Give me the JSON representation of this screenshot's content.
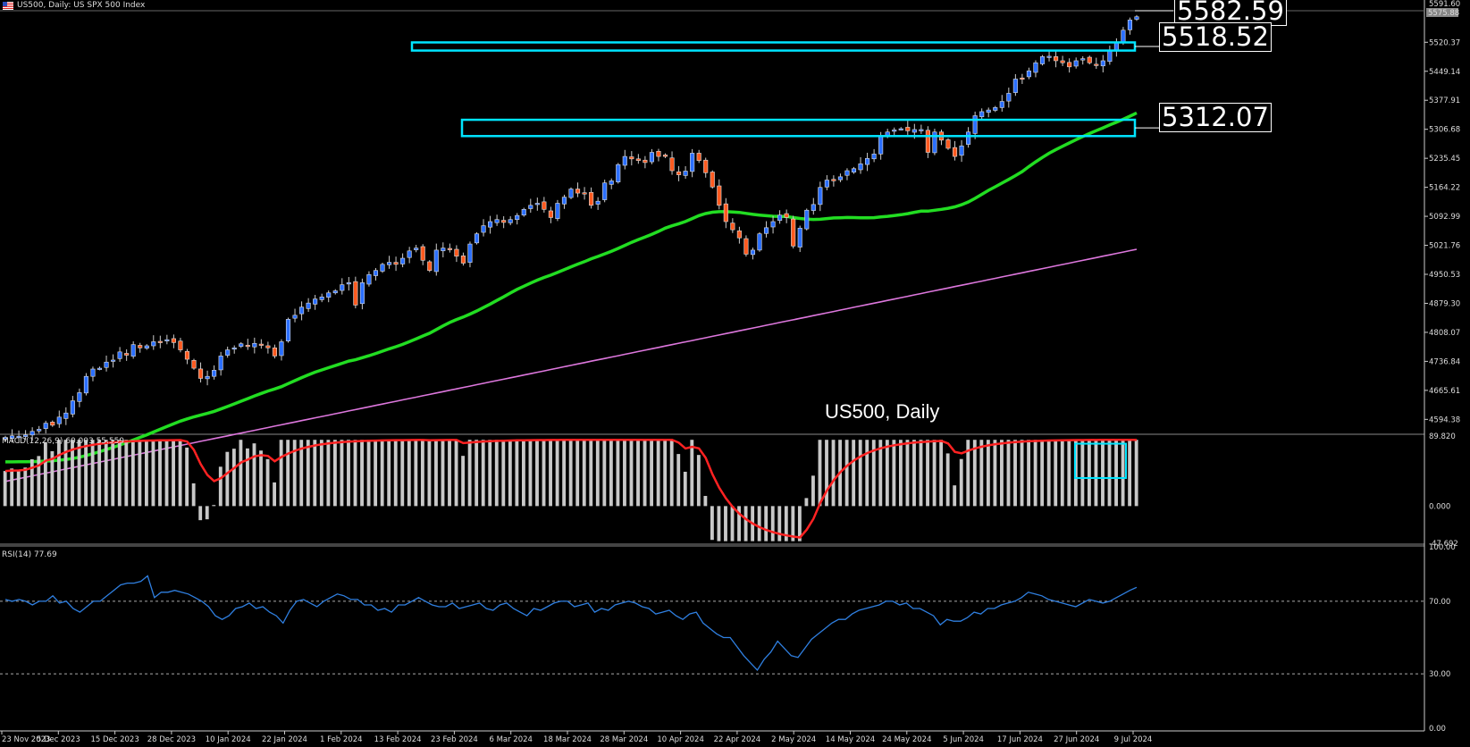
{
  "header": {
    "main_label": "US500, Daily:  US SPX 500 Index",
    "macd_label": "MACD(12,26,9) 60.003 55.559",
    "rsi_label": "RSI(14) 77.69"
  },
  "annotations": {
    "level_top": "5582.59",
    "level_mid": "5518.52",
    "level_low": "5312.07",
    "title": "US500, Daily"
  },
  "price_axis": {
    "ticks": [
      "5520.37",
      "5449.14",
      "5377.91",
      "5306.68",
      "5235.45",
      "5164.22",
      "5092.99",
      "5021.76",
      "4950.53",
      "4879.30",
      "4808.07",
      "4736.84",
      "4665.61",
      "4594.38"
    ],
    "top_tick": "5591.60",
    "current_tag": "5575.88"
  },
  "macd_axis": {
    "ticks": [
      "89.820",
      "0.000",
      "-47.692"
    ]
  },
  "rsi_axis": {
    "ticks": [
      "100.00",
      "70.00",
      "30.00",
      "0.00"
    ]
  },
  "x_axis": {
    "labels": [
      "23 Nov 2023",
      "5 Dec 2023",
      "15 Dec 2023",
      "28 Dec 2023",
      "10 Jan 2024",
      "22 Jan 2024",
      "1 Feb 2024",
      "13 Feb 2024",
      "23 Feb 2024",
      "6 Mar 2024",
      "18 Mar 2024",
      "28 Mar 2024",
      "10 Apr 2024",
      "22 Apr 2024",
      "2 May 2024",
      "14 May 2024",
      "24 May 2024",
      "5 Jun 2024",
      "17 Jun 2024",
      "27 Jun 2024",
      "9 Jul 2024"
    ]
  },
  "colors": {
    "background": "#000000",
    "bull": "#2b6fff",
    "bear": "#ff5a1f",
    "ma50": "#22dd22",
    "ma200": "#dd77dd",
    "macd_hist": "#c8c8c8",
    "macd_signal": "#ff2222",
    "rsi": "#2f7fe0",
    "zone": "#00e5ff"
  },
  "chart_data": [
    {
      "type": "candlestick",
      "title": "US500, Daily",
      "x_range": [
        "23 Nov 2023",
        "9 Jul 2024"
      ],
      "ylim": [
        4560,
        5600
      ],
      "closes": [
        4550,
        4554,
        4553,
        4556,
        4565,
        4570,
        4585,
        4580,
        4600,
        4610,
        4640,
        4660,
        4700,
        4718,
        4720,
        4735,
        4740,
        4760,
        4752,
        4778,
        4770,
        4775,
        4785,
        4785,
        4790,
        4783,
        4765,
        4742,
        4720,
        4695,
        4700,
        4715,
        4750,
        4765,
        4770,
        4780,
        4775,
        4781,
        4776,
        4770,
        4750,
        4785,
        4840,
        4850,
        4870,
        4880,
        4890,
        4895,
        4905,
        4910,
        4925,
        4930,
        4875,
        4930,
        4950,
        4960,
        4975,
        4980,
        4975,
        4990,
        5008,
        5015,
        4985,
        4960,
        5010,
        5015,
        5012,
        4995,
        4978,
        5025,
        5050,
        5070,
        5080,
        5085,
        5078,
        5085,
        5095,
        5110,
        5120,
        5125,
        5110,
        5090,
        5125,
        5140,
        5160,
        5150,
        5150,
        5120,
        5130,
        5175,
        5180,
        5220,
        5240,
        5234,
        5230,
        5225,
        5250,
        5240,
        5240,
        5205,
        5195,
        5204,
        5248,
        5230,
        5200,
        5165,
        5120,
        5080,
        5060,
        5040,
        5000,
        5010,
        5050,
        5065,
        5080,
        5096,
        5090,
        5020,
        5064,
        5108,
        5122,
        5164,
        5182,
        5180,
        5190,
        5205,
        5210,
        5222,
        5235,
        5246,
        5290,
        5300,
        5305,
        5308,
        5303,
        5306,
        5306,
        5250,
        5300,
        5280,
        5260,
        5240,
        5266,
        5300,
        5340,
        5350,
        5354,
        5360,
        5375,
        5395,
        5430,
        5432,
        5450,
        5470,
        5485,
        5486,
        5475,
        5470,
        5460,
        5475,
        5480,
        5470,
        5465,
        5475,
        5500,
        5520,
        5550,
        5575,
        5583
      ],
      "ma50_start": 4550,
      "ma50_end": 5345,
      "ma200_start": 4562,
      "ma200_end": 5012,
      "resistance_zones": [
        {
          "price_low": 5500,
          "price_high": 5520,
          "label": "5518.52"
        },
        {
          "price_low": 5290,
          "price_high": 5330,
          "label": "5312.07"
        }
      ],
      "marked_levels": [
        "5582.59",
        "5518.52",
        "5312.07"
      ]
    },
    {
      "type": "bar",
      "name": "MACD(12,26,9)",
      "main": 60.003,
      "signal": 55.559,
      "ylim": [
        -47.692,
        89.82
      ]
    },
    {
      "type": "line",
      "name": "RSI(14)",
      "last": 77.69,
      "levels": [
        70,
        30
      ],
      "ylim": [
        0,
        100
      ],
      "values": [
        71,
        70,
        71,
        70,
        68,
        70,
        70,
        73,
        69,
        70,
        66,
        64,
        67,
        70,
        70,
        73,
        76,
        79,
        80,
        80,
        81,
        84,
        72,
        75,
        75,
        76,
        75,
        74,
        72,
        70,
        67,
        62,
        60,
        62,
        66,
        67,
        69,
        66,
        67,
        64,
        62,
        58,
        65,
        70,
        71,
        69,
        67,
        70,
        72,
        74,
        73,
        71,
        71,
        68,
        68,
        65,
        66,
        64,
        68,
        68,
        70,
        72,
        70,
        68,
        67,
        67,
        69,
        66,
        67,
        68,
        69,
        66,
        65,
        68,
        69,
        66,
        64,
        62,
        66,
        65,
        67,
        69,
        70,
        70,
        67,
        68,
        69,
        64,
        66,
        65,
        68,
        69,
        70,
        69,
        67,
        66,
        63,
        64,
        65,
        62,
        60,
        63,
        64,
        58,
        55,
        52,
        50,
        50,
        45,
        40,
        36,
        32,
        38,
        42,
        48,
        44,
        40,
        39,
        44,
        49,
        52,
        55,
        58,
        60,
        60,
        63,
        65,
        66,
        67,
        68,
        70,
        70,
        68,
        69,
        66,
        66,
        64,
        62,
        57,
        60,
        59,
        59,
        61,
        64,
        63,
        66,
        66,
        68,
        69,
        70,
        72,
        75,
        74,
        73,
        71,
        70,
        69,
        68,
        67,
        69,
        71,
        70,
        69,
        70,
        72,
        74,
        76,
        77.69
      ]
    }
  ]
}
